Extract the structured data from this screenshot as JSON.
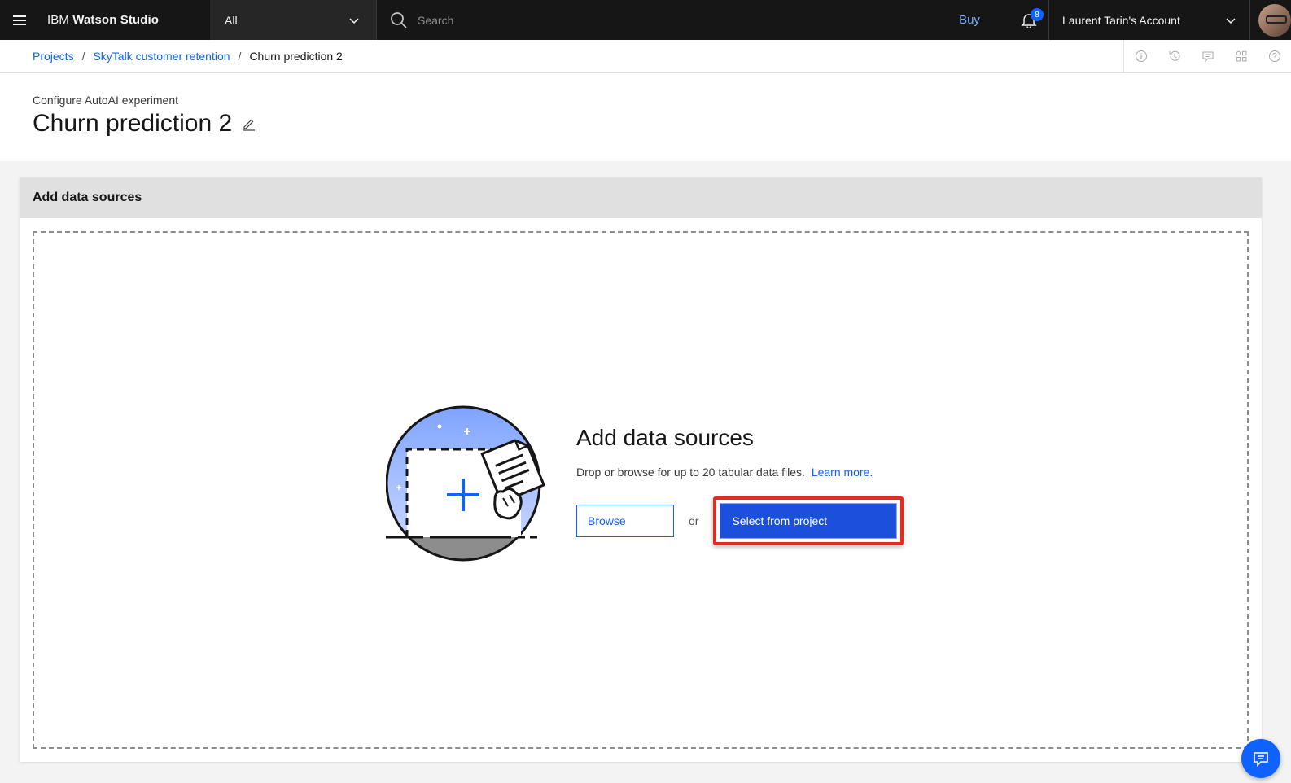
{
  "topbar": {
    "brand_prefix": "IBM",
    "brand_name": "Watson Studio",
    "scope_value": "All",
    "search_placeholder": "Search",
    "buy_label": "Buy",
    "notifications_count": "8",
    "account_label": "Laurent Tarin's Account"
  },
  "breadcrumb": {
    "items": [
      "Projects",
      "SkyTalk customer retention"
    ],
    "current": "Churn prediction 2",
    "separator": "/"
  },
  "header": {
    "subtitle": "Configure AutoAI experiment",
    "title": "Churn prediction 2"
  },
  "panel": {
    "title": "Add data sources",
    "heading": "Add data sources",
    "desc_prefix": "Drop or browse for up to 20",
    "desc_tab": "tabular data files.",
    "learn_more": "Learn more.",
    "browse_label": "Browse",
    "or_label": "or",
    "select_label": "Select from project"
  },
  "colors": {
    "accent": "#0f62fe",
    "highlight": "#e02c22",
    "topbar": "#161616"
  }
}
